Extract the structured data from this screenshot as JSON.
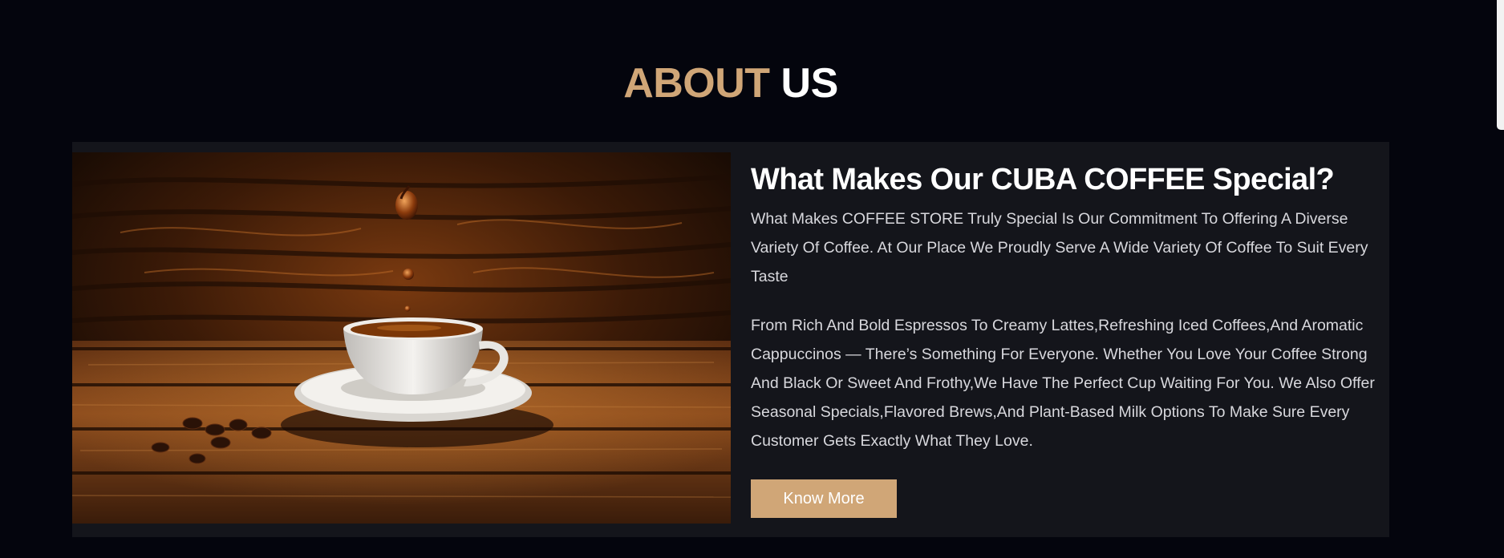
{
  "section": {
    "title_accent": "ABOUT",
    "title_plain": "US"
  },
  "about": {
    "heading": "What Makes Our CUBA COFFEE Special?",
    "paragraph1": "What Makes COFFEE STORE Truly Special Is Our Commitment To Offering A Diverse Variety Of Coffee. At Our Place We Proudly Serve A Wide Variety Of Coffee To Suit Every Taste",
    "paragraph2": "From Rich And Bold Espressos To Creamy Lattes,Refreshing Iced Coffees,And Aromatic Cappuccinos — There’s Something For Everyone. Whether You Love Your Coffee Strong And Black Or Sweet And Frothy,We Have The Perfect Cup Waiting For You. We Also Offer Seasonal Specials,Flavored Brews,And Plant-Based Milk Options To Make Sure Every Customer Gets Exactly What They Love.",
    "button_label": "Know More"
  },
  "colors": {
    "background": "#04050d",
    "card": "#14151b",
    "accent": "#d0a677",
    "text": "#ffffff"
  }
}
